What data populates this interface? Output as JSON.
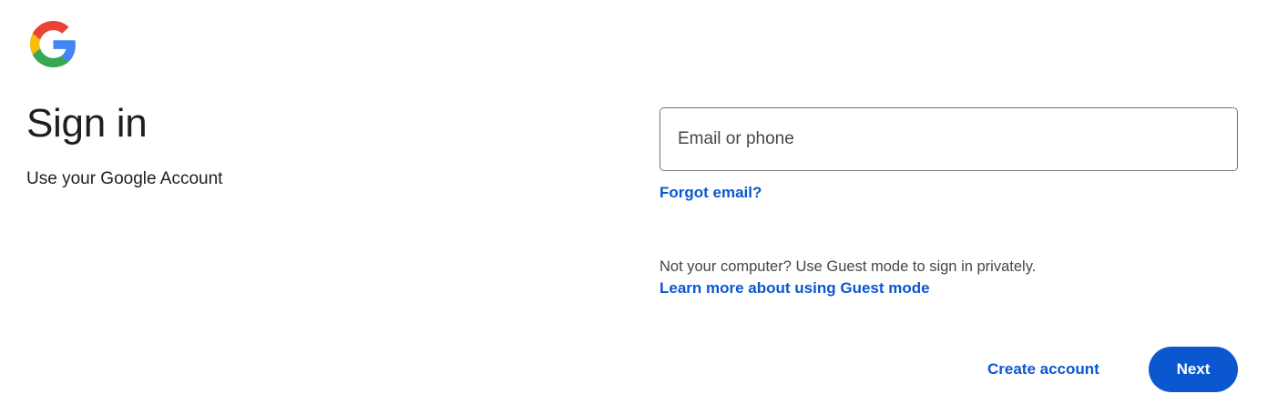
{
  "header": {
    "logo_icon": "google-g-logo-icon"
  },
  "main": {
    "title": "Sign in",
    "subtitle": "Use your Google Account"
  },
  "form": {
    "email_placeholder": "Email or phone",
    "email_value": "",
    "forgot_email_label": "Forgot email?",
    "guest_text": "Not your computer? Use Guest mode to sign in privately.",
    "guest_link_label": "Learn more about using Guest mode"
  },
  "actions": {
    "create_account_label": "Create account",
    "next_label": "Next"
  },
  "colors": {
    "accent": "#0b57d0",
    "text_primary": "#1f1f1f",
    "text_secondary": "#444746",
    "field_border": "#747775",
    "background": "#ffffff"
  }
}
